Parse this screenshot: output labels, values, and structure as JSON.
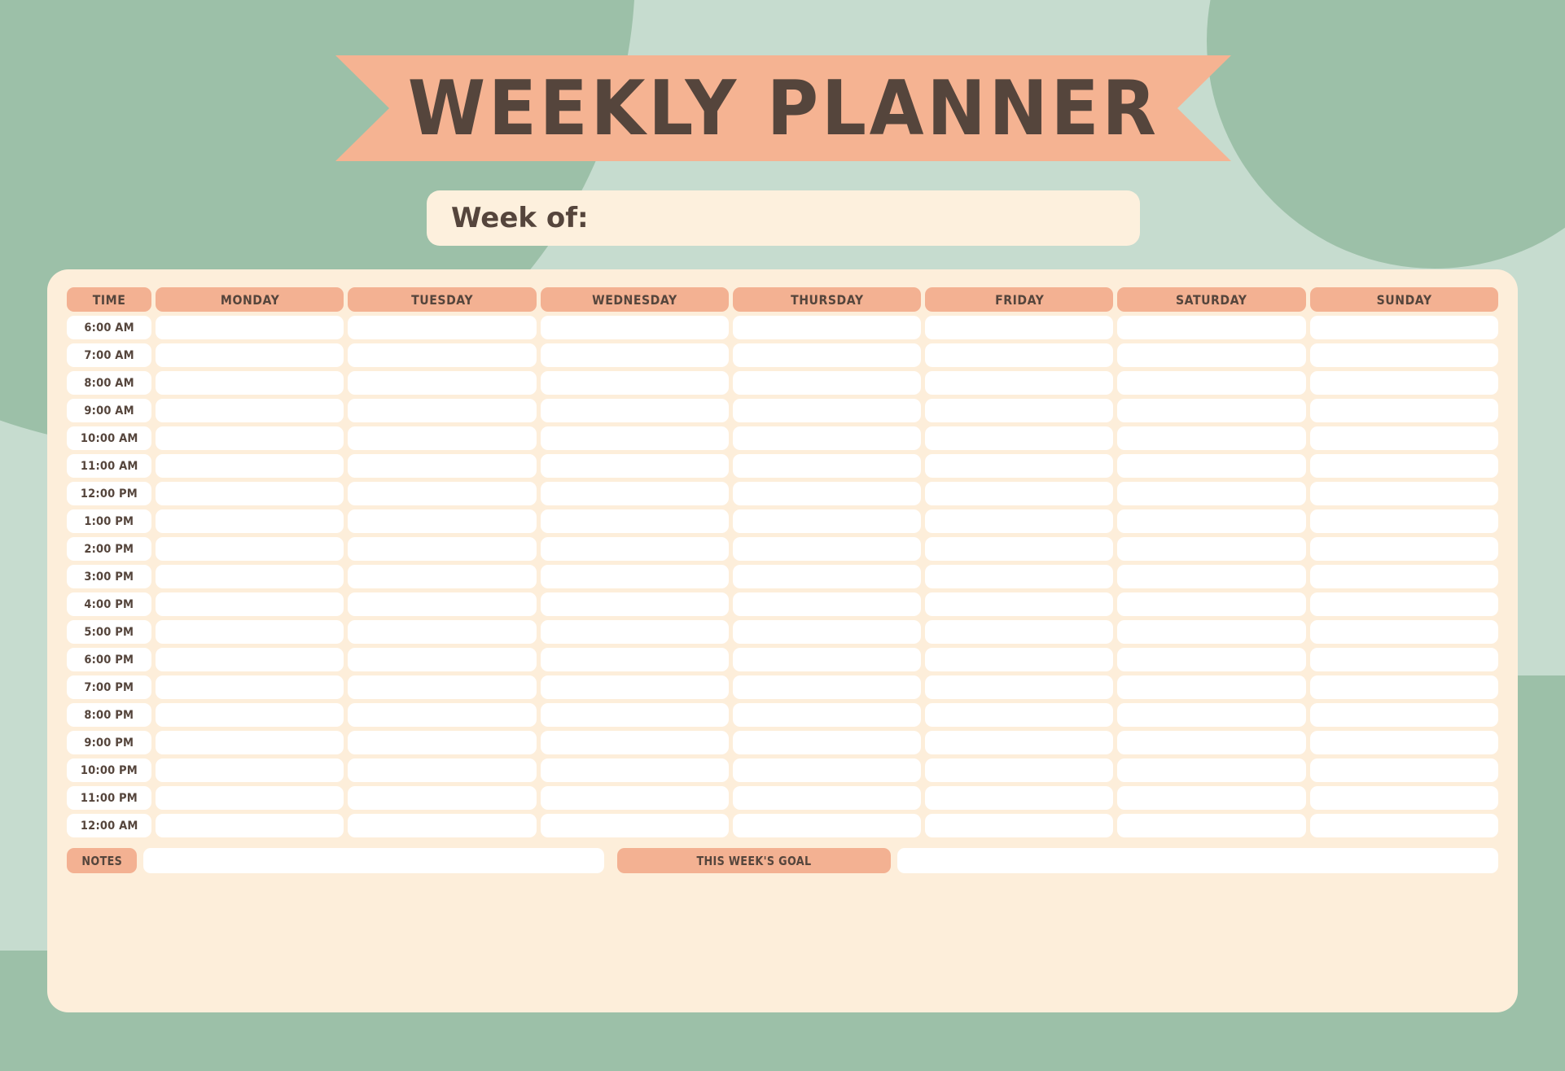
{
  "theme": {
    "bg_mint": "#c6dccf",
    "bg_green_dark": "#9cc0a8",
    "salmon": "#f3b192",
    "banner_salmon": "#f5b392",
    "cream_card": "#fdeeda",
    "cream_field": "#fdf0dd",
    "ink_brown": "#55453c",
    "white": "#ffffff"
  },
  "banner": {
    "title": "WEEKLY PLANNER"
  },
  "week_of": {
    "label": "Week of:",
    "value": "",
    "placeholder": ""
  },
  "schedule": {
    "columns": [
      "TIME",
      "MONDAY",
      "TUESDAY",
      "WEDNESDAY",
      "THURSDAY",
      "FRIDAY",
      "SATURDAY",
      "SUNDAY"
    ],
    "times": [
      "6:00 AM",
      "7:00 AM",
      "8:00 AM",
      "9:00 AM",
      "10:00 AM",
      "11:00 AM",
      "12:00 PM",
      "1:00 PM",
      "2:00 PM",
      "3:00 PM",
      "4:00 PM",
      "5:00 PM",
      "6:00 PM",
      "7:00 PM",
      "8:00 PM",
      "9:00 PM",
      "10:00 PM",
      "11:00 PM",
      "12:00 AM"
    ],
    "entries": []
  },
  "notes": {
    "label": "NOTES",
    "lines": [
      "",
      "",
      "",
      "",
      ""
    ]
  },
  "goal": {
    "label": "THIS WEEK'S GOAL",
    "lines": [
      "",
      "",
      "",
      "",
      ""
    ]
  }
}
